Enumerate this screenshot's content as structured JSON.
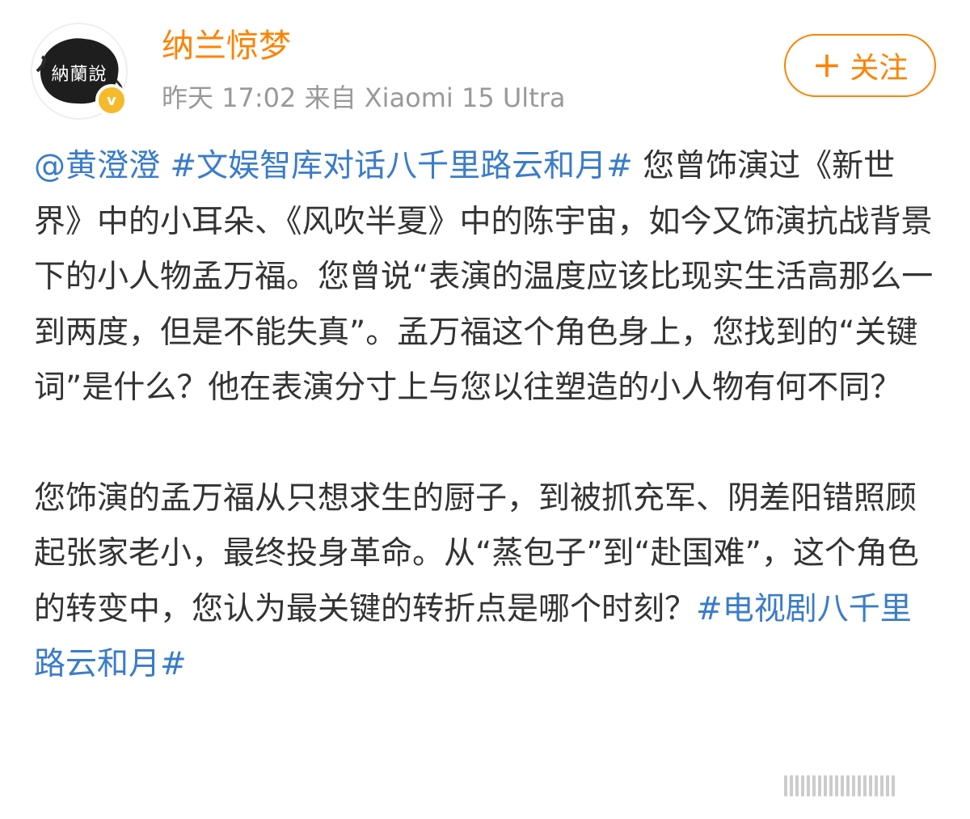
{
  "post": {
    "author": {
      "name": "纳兰惊梦",
      "avatar_text": "納蘭說",
      "verified_mark": "v"
    },
    "meta": {
      "time": "昨天 17:02",
      "source": "来自 Xiaomi 15 Ultra"
    },
    "follow": {
      "icon": "plus-icon",
      "plus": "+",
      "label": "关注"
    },
    "para1": {
      "mention": "@黄澄澄",
      "hashtag": "#文娱智库对话八千里路云和月#",
      "text": " 您曾饰演过《新世界》中的小耳朵、《风吹半夏》中的陈宇宙，如今又饰演抗战背景下的小人物孟万福。您曾说“表演的温度应该比现实生活高那么一到两度，但是不能失真”。孟万福这个角色身上，您找到的“关键词”是什么？他在表演分寸上与您以往塑造的小人物有何不同？"
    },
    "para2": {
      "text": "您饰演的孟万福从只想求生的厨子，到被抓充军、阴差阳错照顾起张家老小，最终投身革命。从“蒸包子”到“赴国难”，这个角色的转变中，您认为最关键的转折点是哪个时刻？",
      "hashtag": "#电视剧八千里路云和月#"
    },
    "colors": {
      "username": "#ff8200",
      "link": "#3a7cc9",
      "meta": "#999999",
      "verified": "#f6b92b"
    }
  }
}
